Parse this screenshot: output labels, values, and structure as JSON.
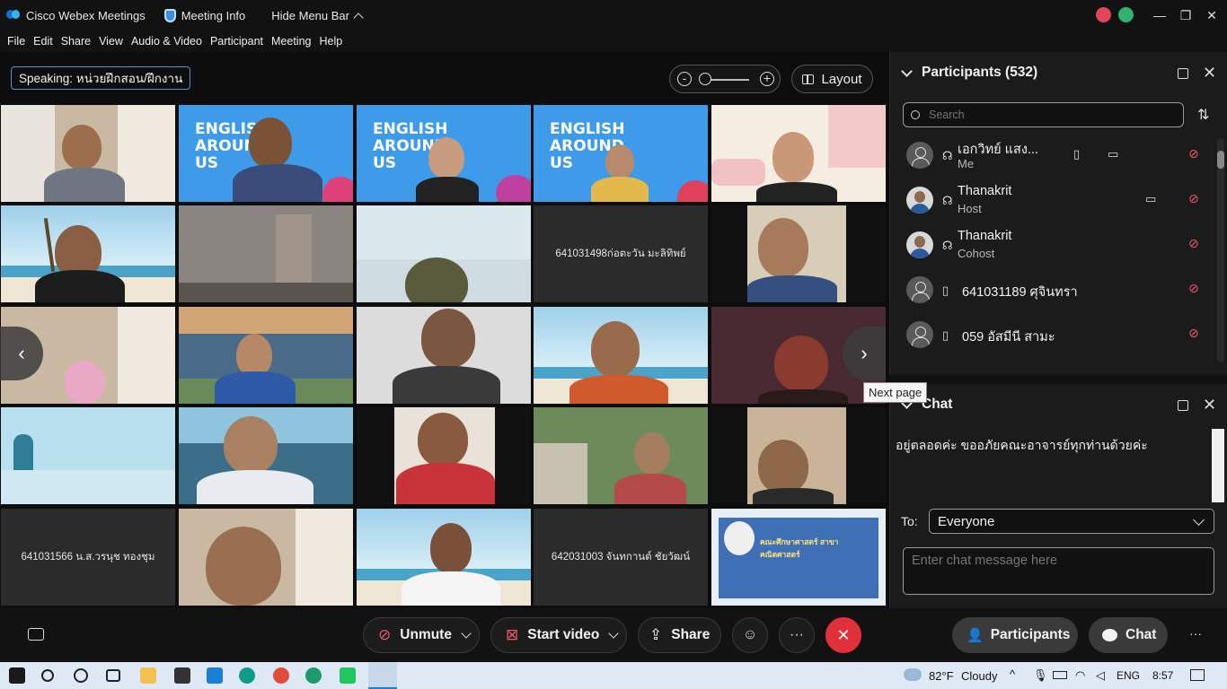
{
  "titlebar": {
    "app": "Cisco Webex Meetings",
    "meeting_info": "Meeting Info",
    "hide_menu": "Hide Menu Bar",
    "chevron": "^",
    "minimize": "—",
    "restore": "❐",
    "close": "✕"
  },
  "menubar": [
    "File",
    "Edit",
    "Share",
    "View",
    "Audio & Video",
    "Participant",
    "Meeting",
    "Help"
  ],
  "stage": {
    "speaking": "Speaking: หน่วยฝึกสอน/ฝึกงาน",
    "layout_label": "Layout",
    "next_tooltip": "Next page",
    "english_text": "ENGLISH AROUND US",
    "tiles": {
      "r2c4": "641031498ก่อตะวัน มะลิทิพย์",
      "r5c1": "641031566 น.ส.วรนุช ทองชุม",
      "r5c4": "642031003 จันทกานต์ ชัยวัฒน์",
      "r5c5": "คณะศึกษาศาสตร์ สาขาคณิตศาสตร์"
    }
  },
  "participants_panel": {
    "title": "Participants (532)",
    "search_placeholder": "Search",
    "rows": [
      {
        "name": "เอกวิทย์ แสง...",
        "role": "Me"
      },
      {
        "name": "Thanakrit",
        "role": "Host"
      },
      {
        "name": "Thanakrit",
        "role": "Cohost"
      },
      {
        "name": "641031189 ศุจินทรา",
        "role": ""
      },
      {
        "name": "059 อัสมีนี สามะ",
        "role": ""
      }
    ]
  },
  "chat_panel": {
    "title": "Chat",
    "message": "อยู่ตลอดค่ะ ขออภัยคณะอาจารย์ทุกท่านด้วยค่ะ",
    "to_label": "To:",
    "to_value": "Everyone",
    "input_placeholder": "Enter chat message here"
  },
  "controls": {
    "unmute": "Unmute",
    "start_video": "Start video",
    "share": "Share",
    "more": "···",
    "participants": "Participants",
    "chat": "Chat"
  },
  "taskbar": {
    "weather_temp": "82°F",
    "weather_desc": "Cloudy",
    "lang": "ENG",
    "time": "8:57"
  }
}
